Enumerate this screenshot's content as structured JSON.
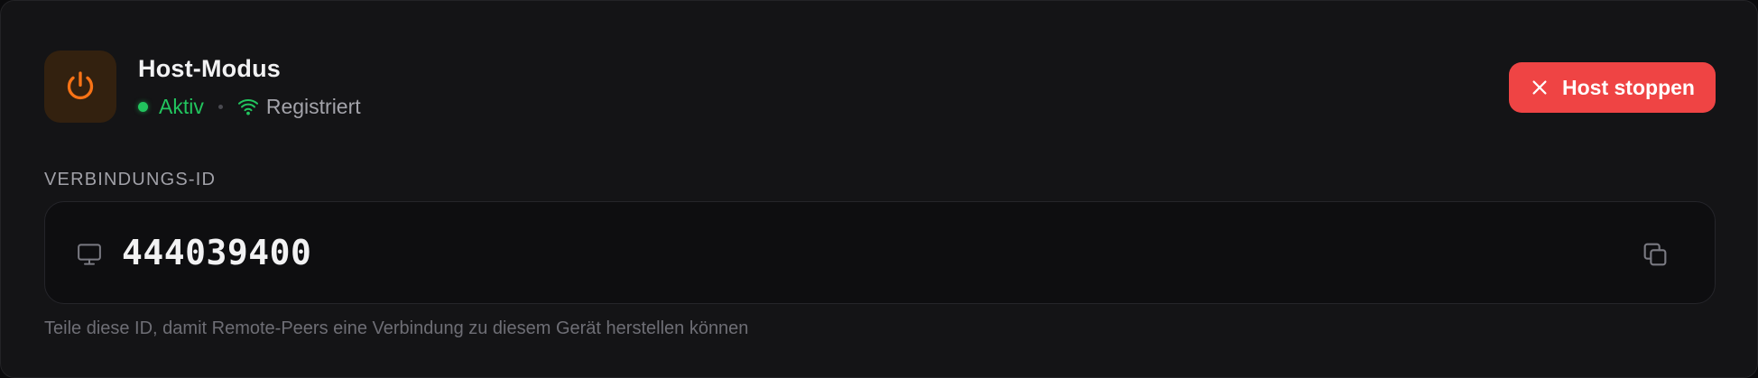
{
  "header": {
    "title": "Host-Modus",
    "status_active": "Aktiv",
    "status_registered": "Registriert",
    "power_icon": "power-icon",
    "wifi_icon": "wifi-icon"
  },
  "actions": {
    "stop_label": "Host stoppen",
    "stop_icon": "x-icon"
  },
  "connection": {
    "label": "VERBINDUNGS-ID",
    "id": "444039400",
    "monitor_icon": "monitor-icon",
    "copy_icon": "copy-icon",
    "hint": "Teile diese ID, damit Remote-Peers eine Verbindung zu diesem Gerät herstellen können"
  },
  "colors": {
    "accent_orange": "#f97316",
    "active_green": "#22c55e",
    "danger_red": "#ef4444",
    "background": "#141416"
  }
}
